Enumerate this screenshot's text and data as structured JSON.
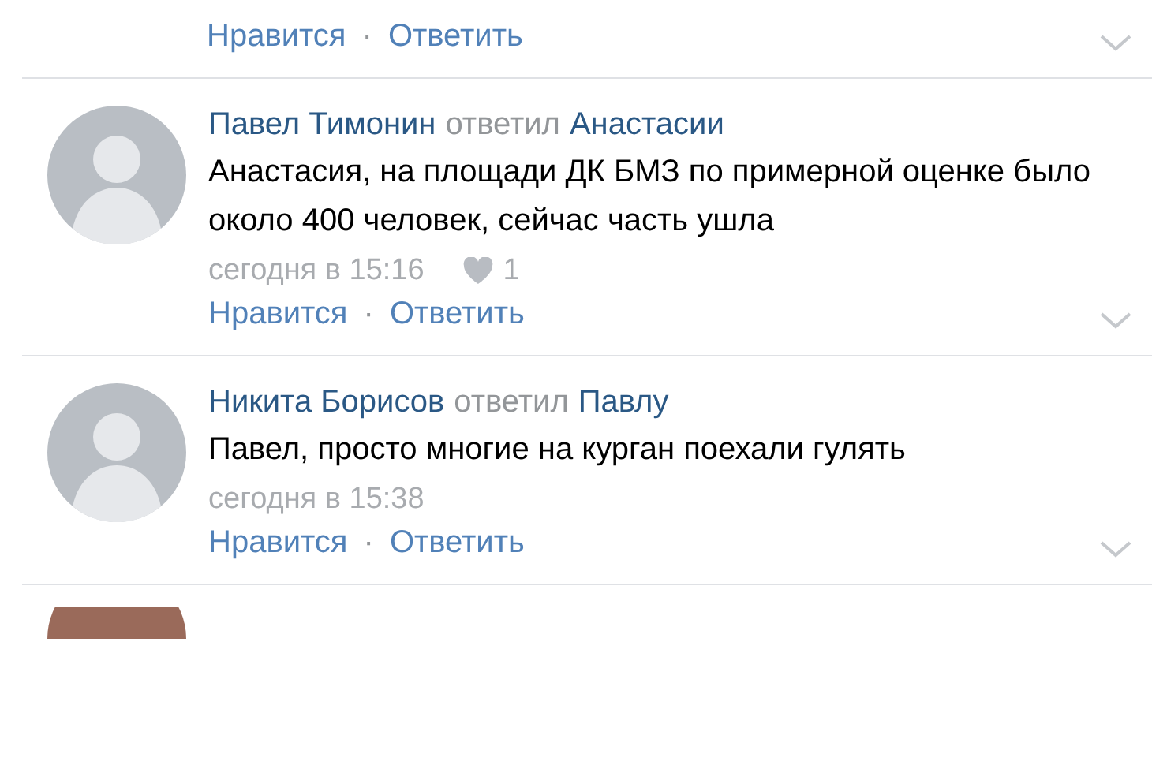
{
  "top_actions": {
    "like": "Нравится",
    "separator": "·",
    "reply": "Ответить"
  },
  "comments": [
    {
      "author": "Павел Тимонин",
      "reply_word": "ответил",
      "target": "Анастасии",
      "text": "Анастасия, на площади ДК БМЗ по примерной оценке было около 400 человек, сейчас часть ушла",
      "time": "сегодня в 15:16",
      "likes": "1",
      "like": "Нравится",
      "separator": "·",
      "reply": "Ответить"
    },
    {
      "author": "Никита Борисов",
      "reply_word": "ответил",
      "target": "Павлу",
      "text": "Павел, просто многие на курган поехали гулять",
      "time": "сегодня в 15:38",
      "like": "Нравится",
      "separator": "·",
      "reply": "Ответить"
    }
  ]
}
